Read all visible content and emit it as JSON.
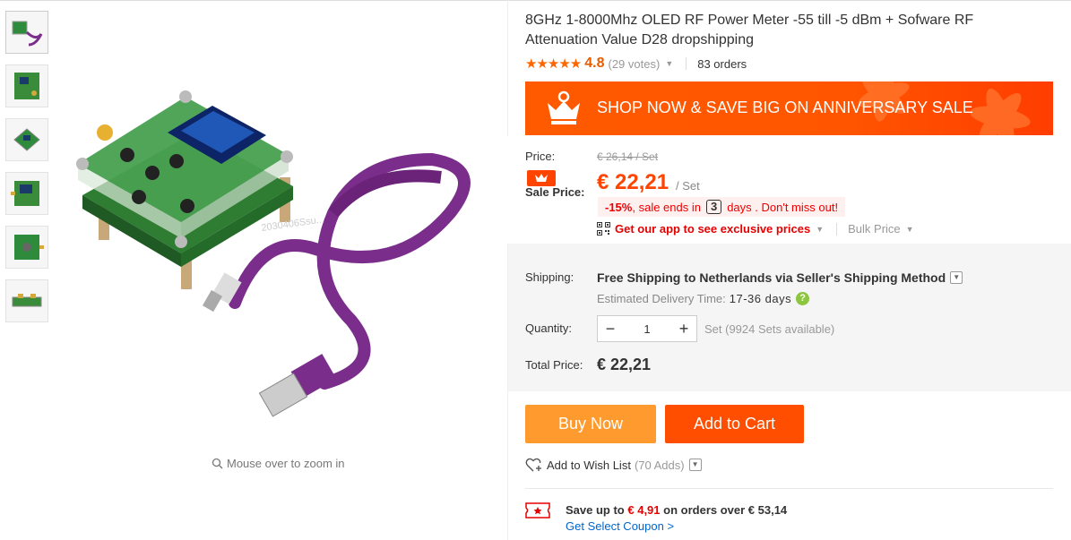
{
  "gallery": {
    "thumbnails": [
      "thumb-1",
      "thumb-2",
      "thumb-3",
      "thumb-4",
      "thumb-5",
      "thumb-6"
    ],
    "zoom_hint": "Mouse over to zoom in",
    "watermark": "2030406Ssu..."
  },
  "product": {
    "title": "8GHz 1-8000Mhz OLED RF Power Meter -55 till -5 dBm + Sofware RF Attenuation Value D28 dropshipping",
    "rating_stars": "★★★★★",
    "rating": "4.8",
    "votes": "(29 votes)",
    "orders": "83 orders"
  },
  "banner": {
    "text": "SHOP NOW & SAVE BIG ON ANNIVERSARY SALE"
  },
  "price": {
    "price_label": "Price:",
    "original": "€ 26,14 / Set",
    "sale_label": "Sale Price:",
    "sale_price": "€ 22,21",
    "per_unit": "/ Set",
    "discount_pct": "-15%",
    "discount_text": ", sale ends in",
    "days": "3",
    "discount_tail": "days . Don't miss out!",
    "app_text": "Get our app to see exclusive prices",
    "bulk_text": "Bulk Price"
  },
  "shipping": {
    "label": "Shipping:",
    "text": "Free Shipping to Netherlands via Seller's Shipping Method",
    "delivery_label": "Estimated Delivery Time:",
    "delivery_days": "17-36 days"
  },
  "quantity": {
    "label": "Quantity:",
    "value": "1",
    "unit": "Set (9924 Sets available)"
  },
  "total": {
    "label": "Total Price:",
    "value": "€ 22,21"
  },
  "actions": {
    "buy_now": "Buy Now",
    "add_to_cart": "Add to Cart",
    "wish_list": "Add to Wish List",
    "wish_count": "(70 Adds)"
  },
  "coupon": {
    "save_prefix": "Save up to",
    "save_amount": "€ 4,91",
    "save_suffix": "on orders over € 53,14",
    "link": "Get Select Coupon >"
  },
  "colors": {
    "accent": "#ff4e00",
    "buy_now": "#ff9a2e",
    "sale_red": "#ff4400",
    "rating_orange": "#ff6600",
    "link_blue": "#0066cc"
  }
}
